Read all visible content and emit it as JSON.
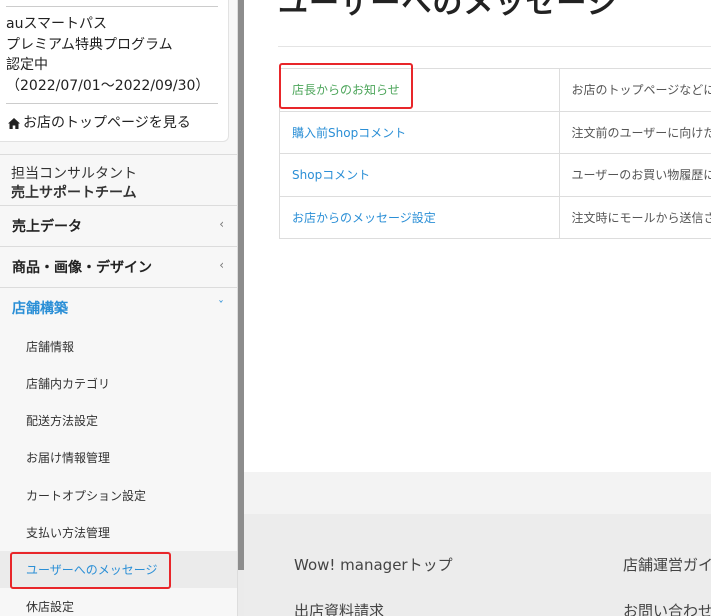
{
  "sidebar": {
    "award": {
      "lines": [
        "auスマートパス",
        "プレミアム特典プログラム",
        "認定中",
        "（2022/07/01～2022/09/30）"
      ],
      "store_link": "お店のトップページを見る"
    },
    "consultant": {
      "label": "担当コンサルタント",
      "team": "売上サポートチーム"
    },
    "categories": [
      {
        "label": "売上データ",
        "chevron": "‹"
      },
      {
        "label": "商品・画像・デザイン",
        "chevron": "‹"
      },
      {
        "label": "店舗構築",
        "chevron": "ˇ"
      }
    ],
    "sub_items": [
      {
        "label": "店舗情報"
      },
      {
        "label": "店舗内カテゴリ"
      },
      {
        "label": "配送方法設定"
      },
      {
        "label": "お届け情報管理"
      },
      {
        "label": "カートオプション設定"
      },
      {
        "label": "支払い方法管理"
      },
      {
        "label": "ユーザーへのメッセージ"
      },
      {
        "label": "休店設定"
      }
    ]
  },
  "main": {
    "title": "ユーザーへのメッセージ",
    "rows": [
      {
        "name": "店長からのお知らせ",
        "desc": "お店のトップページなどに"
      },
      {
        "name": "購入前Shopコメント",
        "desc": "注文前のユーザーに向けた"
      },
      {
        "name": "Shopコメント",
        "desc": "ユーザーのお買い物履歴に"
      },
      {
        "name": "お店からのメッセージ設定",
        "desc": "注文時にモールから送信さ"
      }
    ]
  },
  "footer": {
    "links": [
      "Wow! managerトップ",
      "店舗運営ガイ",
      "出店資料請求",
      "お問い合わせ"
    ]
  },
  "colors": {
    "accent": "#2b8fd6",
    "highlight": "#e8262a",
    "active_row_text": "#4ca55a"
  }
}
